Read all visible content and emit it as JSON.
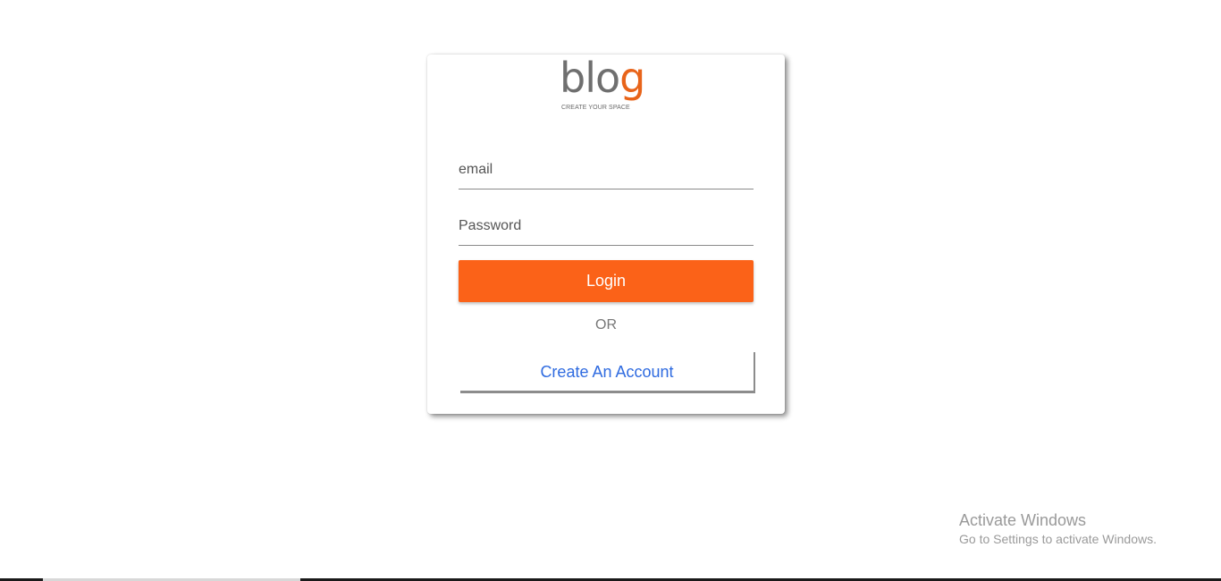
{
  "brand": {
    "logo_main": "blo",
    "logo_accent": "g",
    "tagline": "CREATE YOUR SPACE",
    "text_color": "#6f6f6f",
    "accent_color": "#e8641a"
  },
  "login_form": {
    "email_placeholder": "email",
    "email_value": "",
    "password_placeholder": "Password",
    "password_value": "",
    "login_label": "Login",
    "login_color": "#fb6218",
    "or_text": "OR",
    "create_account_label": "Create An Account",
    "link_color": "#2f6be0"
  },
  "watermark": {
    "title": "Activate Windows",
    "subtitle": "Go to Settings to activate Windows."
  }
}
